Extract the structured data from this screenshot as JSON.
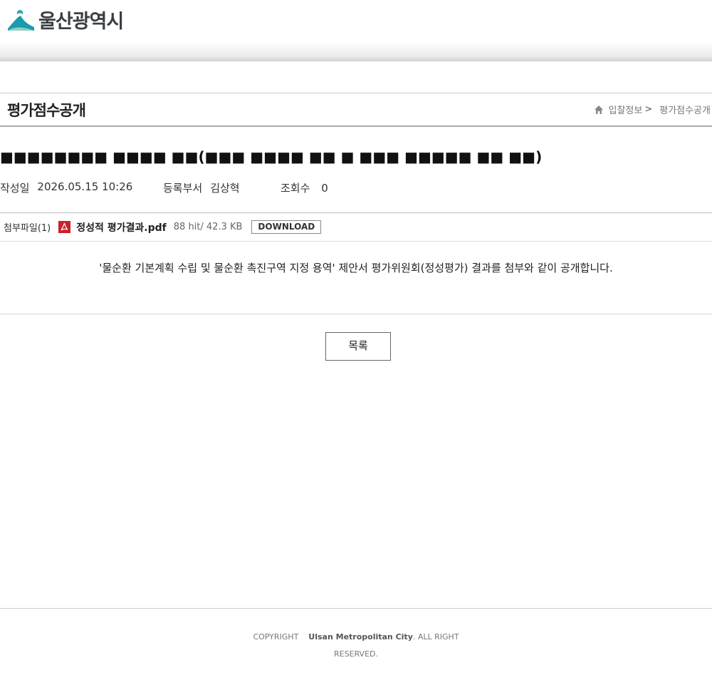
{
  "header": {
    "logo_text": "울산광역시"
  },
  "title_bar": {
    "page_title": "평가점수공개",
    "breadcrumb": {
      "parent": "입찰정보",
      "separator": ">",
      "current": "평가점수공개"
    }
  },
  "post": {
    "title": "■■■■■■■■ ■■■■ ■■(■■■ ■■■■ ■■ ■ ■■■ ■■■■■ ■■ ■■)",
    "meta": {
      "date_label": "작성일",
      "date_value": "2026.05.15 10:26",
      "dept_label": "등록부서",
      "dept_value": "김상혁",
      "views_label": "조회수",
      "views_value": "0"
    },
    "attachment": {
      "label": "첨부파일(1)",
      "file_name": "정성적 평가결과.pdf",
      "file_info": "88 hit/ 42.3 KB",
      "download_label": "DOWNLOAD"
    },
    "content": "'물순환 기본계획 수립 및 물순환 촉진구역 지정 용역' 제안서 평가위원회(정성평가) 결과를 첨부와 같이 공개합니다."
  },
  "actions": {
    "list_label": "목록"
  },
  "footer": {
    "copyright_prefix": "COPYRIGHT",
    "city": "Ulsan Metropolitan City",
    "suffix_1": ". ALL RIGHT",
    "suffix_2": "RESERVED."
  },
  "colors": {
    "logo_teal": "#1a9bb0",
    "pdf_red": "#c8222a",
    "text": "#222222"
  },
  "icons": [
    "ulsan-logo-icon",
    "home-icon",
    "pdf-icon"
  ]
}
